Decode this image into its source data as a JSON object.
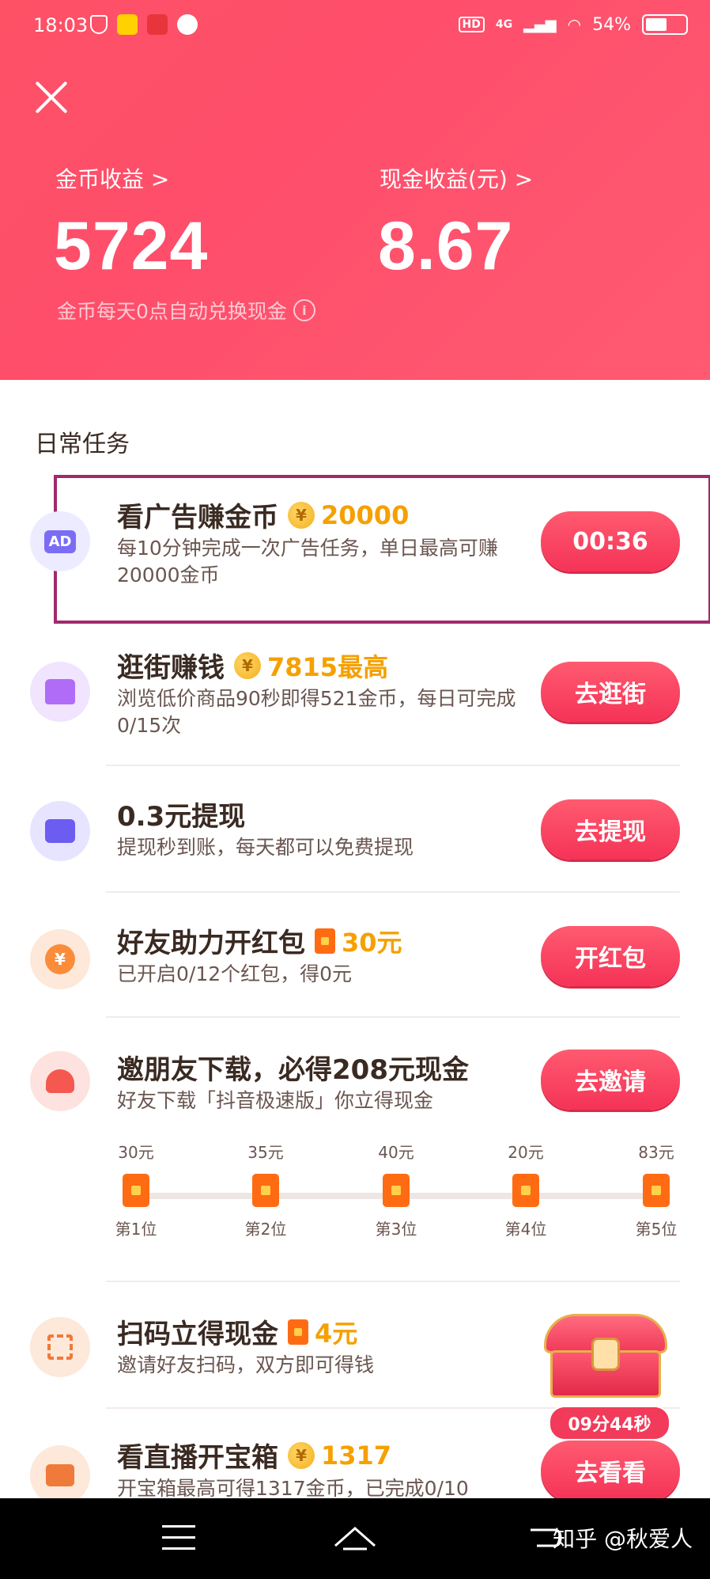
{
  "status_bar": {
    "time": "18:03",
    "network": "4G",
    "battery": "54%",
    "battery_level": 0.54
  },
  "header": {
    "coin_label": "金币收益 >",
    "coin_value": "5724",
    "cash_label": "现金收益(元) >",
    "cash_value": "8.67",
    "hint": "金币每天0点自动兑换现金"
  },
  "section_title": "日常任务",
  "tasks": [
    {
      "title": "看广告赚金币",
      "reward": "20000",
      "desc": "每10分钟完成一次广告任务，单日最高可赚20000金币",
      "button": "00:36",
      "icon": "ad-icon"
    },
    {
      "title": "逛街赚钱",
      "reward": "7815最高",
      "desc": "浏览低价商品90秒即得521金币，每日可完成0/15次",
      "button": "去逛街",
      "icon": "shop-icon"
    },
    {
      "title": "0.3元提现",
      "reward": "",
      "desc": "提现秒到账，每天都可以免费提现",
      "button": "去提现",
      "icon": "wallet-icon"
    },
    {
      "title": "好友助力开红包",
      "reward": "30元",
      "desc": "已开启0/12个红包，得0元",
      "button": "开红包",
      "icon": "yuan-icon"
    },
    {
      "title": "邀朋友下载，必得208元现金",
      "reward": "",
      "desc": "好友下载「抖音极速版」你立得现金",
      "button": "去邀请",
      "icon": "invite-icon"
    },
    {
      "title": "扫码立得现金",
      "reward": "4元",
      "desc": "邀请好友扫码，双方即可得钱",
      "button": "",
      "icon": "scan-icon"
    },
    {
      "title": "看直播开宝箱",
      "reward": "1317",
      "desc": "开宝箱最高可得1317金币，已完成0/10",
      "button": "去看看",
      "icon": "tv-icon"
    }
  ],
  "invite_progress": [
    {
      "amount": "30元",
      "position": "第1位"
    },
    {
      "amount": "35元",
      "position": "第2位"
    },
    {
      "amount": "40元",
      "position": "第3位"
    },
    {
      "amount": "20元",
      "position": "第4位"
    },
    {
      "amount": "83元",
      "position": "第5位"
    }
  ],
  "chest_timer": "09分44秒",
  "watermark": "知乎 @秋爱人",
  "colors": {
    "primary": "#fe5166",
    "reward": "#f5a000",
    "highlight_border": "#a2296b"
  }
}
